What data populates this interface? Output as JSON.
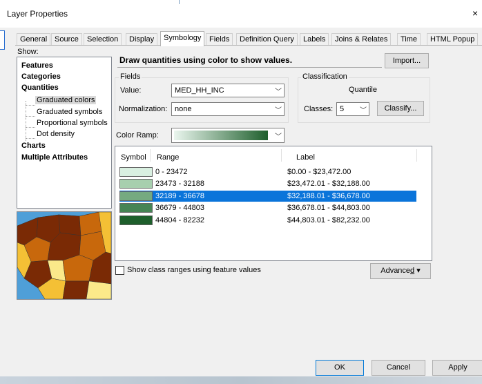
{
  "window": {
    "title": "Layer Properties",
    "close_glyph": "×",
    "close_icon": "close-icon"
  },
  "tabs": [
    {
      "label": "General"
    },
    {
      "label": "Source"
    },
    {
      "label": "Selection"
    },
    {
      "label": "Display"
    },
    {
      "label": "Symbology",
      "active": true
    },
    {
      "label": "Fields"
    },
    {
      "label": "Definition Query"
    },
    {
      "label": "Labels"
    },
    {
      "label": "Joins & Relates"
    },
    {
      "label": "Time"
    },
    {
      "label": "HTML Popup"
    }
  ],
  "show": {
    "label": "Show:",
    "items": {
      "features": "Features",
      "categories": "Categories",
      "quantities": "Quantities",
      "graduated_colors": "Graduated colors",
      "graduated_symbols": "Graduated symbols",
      "proportional_symbols": "Proportional symbols",
      "dot_density": "Dot density",
      "charts": "Charts",
      "multiple_attributes": "Multiple Attributes"
    },
    "selected": "Graduated colors"
  },
  "description": "Draw quantities using color to show values.",
  "import_button": "Import...",
  "fields": {
    "group_label": "Fields",
    "value_label": "Value:",
    "value": "MED_HH_INC",
    "normalization_label": "Normalization:",
    "normalization": "none"
  },
  "classification": {
    "group_label": "Classification",
    "method": "Quantile",
    "classes_label": "Classes:",
    "classes": "5",
    "classify_button": "Classify..."
  },
  "color_ramp": {
    "label": "Color Ramp:",
    "start_color": "#eaf6ee",
    "end_color": "#1e5f2c"
  },
  "table": {
    "headers": {
      "symbol": "Symbol",
      "range": "Range",
      "label": "Label"
    },
    "rows": [
      {
        "color": "#d9f0e1",
        "range": "0 - 23472",
        "label": "$0.00 - $23,472.00",
        "selected": false
      },
      {
        "color": "#a7cfae",
        "range": "23473 - 32188",
        "label": "$23,472.01 - $32,188.00",
        "selected": false
      },
      {
        "color": "#75aa80",
        "range": "32189 - 36678",
        "label": "$32,188.01 - $36,678.00",
        "selected": true
      },
      {
        "color": "#468455",
        "range": "36679 - 44803",
        "label": "$36,678.01 - $44,803.00",
        "selected": false
      },
      {
        "color": "#1e5f2c",
        "range": "44804 - 82232",
        "label": "$44,803.01 - $82,232.00",
        "selected": false
      }
    ],
    "selection_color": "#0a74da"
  },
  "show_class_ranges": {
    "label": "Show class ranges using feature values",
    "checked": false
  },
  "advanced_button": {
    "prefix": "Advance",
    "mnemonic": "d",
    "arrow": "▾"
  },
  "footer": {
    "ok": "OK",
    "cancel": "Cancel",
    "apply": "Apply"
  },
  "preview_colors": {
    "ocean": "#4f9fd8",
    "dark": "#7a2a05",
    "mid": "#c8680c",
    "light": "#f4c035",
    "pale": "#fbe98a"
  }
}
